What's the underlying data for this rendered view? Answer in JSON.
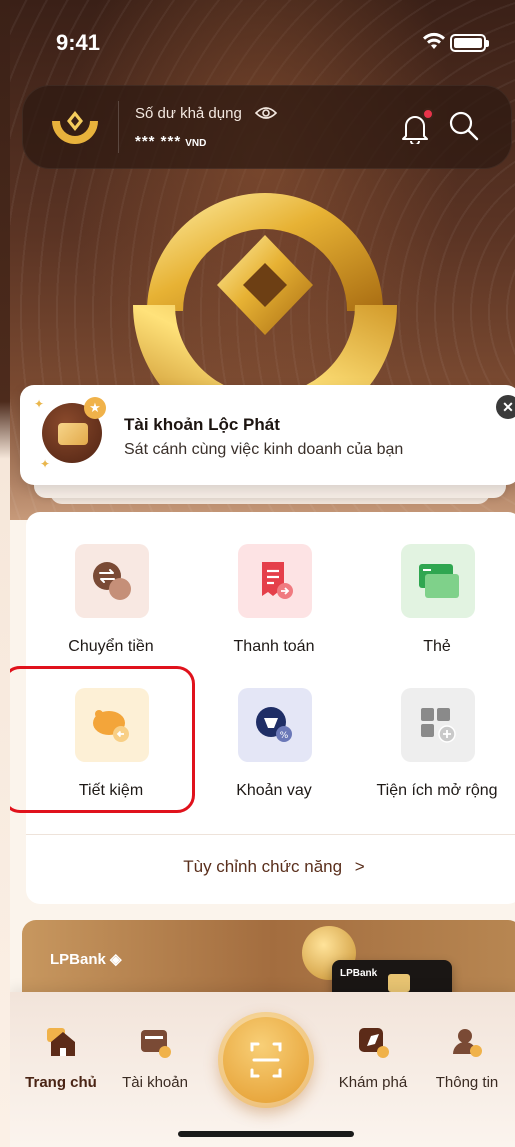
{
  "status_bar": {
    "time": "9:41"
  },
  "balance": {
    "label": "Số dư khả dụng",
    "value": "*** ***",
    "currency": "VND"
  },
  "promo": {
    "title": "Tài khoản Lộc Phát",
    "subtitle": "Sát cánh cùng việc kinh doanh của bạn"
  },
  "services": [
    {
      "label": "Chuyển tiền",
      "icon": "transfer-icon"
    },
    {
      "label": "Thanh toán",
      "icon": "bill-payment-icon"
    },
    {
      "label": "Thẻ",
      "icon": "card-icon"
    },
    {
      "label": "Tiết kiệm",
      "icon": "piggy-bank-icon"
    },
    {
      "label": "Khoản vay",
      "icon": "loan-icon"
    },
    {
      "label": "Tiện ích mở rộng",
      "icon": "apps-grid-icon"
    }
  ],
  "customize_label": "Tùy chỉnh chức năng",
  "banner": {
    "logo": "LPBank",
    "card_logo": "LPBank"
  },
  "bottom_nav": [
    {
      "label": "Trang chủ",
      "icon": "home-icon",
      "active": true
    },
    {
      "label": "Tài khoản",
      "icon": "wallet-icon"
    },
    {
      "label": "Khám phá",
      "icon": "explore-icon"
    },
    {
      "label": "Thông tin",
      "icon": "profile-icon"
    }
  ],
  "colors": {
    "brand_brown": "#5c2b18",
    "brand_gold": "#e8a73e",
    "highlight_red": "#e0121c"
  }
}
